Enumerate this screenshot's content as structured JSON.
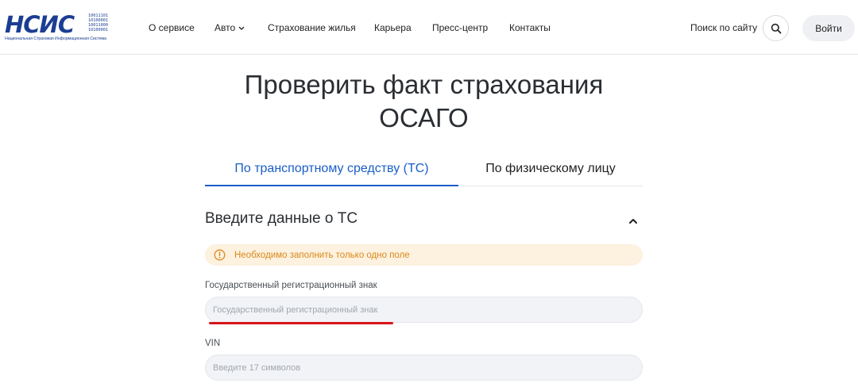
{
  "logo": {
    "mark": "НСИС",
    "bits": [
      "10011101",
      "10100001",
      "10011000",
      "10100001"
    ],
    "subtitle": "Национальная Страховая Информационная Система",
    "brand_color": "#1b3e93"
  },
  "nav": {
    "items": [
      {
        "label": "О сервисе"
      },
      {
        "label": "Авто",
        "has_dropdown": true
      },
      {
        "label": "Страхование жилья"
      },
      {
        "label": "Карьера"
      },
      {
        "label": "Пресс-центр"
      },
      {
        "label": "Контакты"
      }
    ],
    "search_label": "Поиск по сайту",
    "search_icon": "search-icon",
    "login_label": "Войти"
  },
  "main": {
    "title_line1": "Проверить факт страхования",
    "title_line2": "ОСАГО",
    "tabs": [
      {
        "label": "По транспортному средству (ТС)",
        "active": true
      },
      {
        "label": "По физическому лицу",
        "active": false
      }
    ],
    "accent_color": "#1a5ec8",
    "section": {
      "title": "Введите данные о ТС",
      "collapse_icon": "chevron-up-icon",
      "notice": {
        "icon": "warning-icon",
        "text": "Необходимо заполнить только одно поле",
        "color": "#d98a1a",
        "background": "#fdf1df"
      },
      "fields": [
        {
          "label": "Государственный регистрационный знак",
          "placeholder": "Государственный регистрационный знак",
          "value": ""
        },
        {
          "label": "VIN",
          "placeholder": "Введите 17 символов",
          "value": ""
        }
      ]
    },
    "annotation_color": "#d7141a"
  }
}
